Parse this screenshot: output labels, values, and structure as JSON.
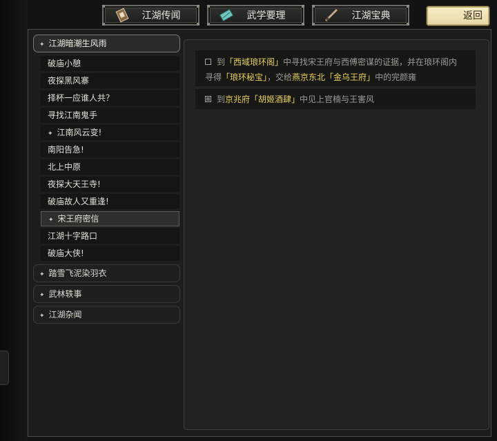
{
  "tabs": [
    {
      "label": "江湖传闻",
      "icon": "scroll-icon"
    },
    {
      "label": "武学要理",
      "icon": "manual-icon"
    },
    {
      "label": "江湖宝典",
      "icon": "sword-icon"
    }
  ],
  "back_label": "返回",
  "chapters": {
    "first": {
      "label": "江湖暗潮生风雨"
    },
    "others": [
      {
        "label": "踏雪飞泥染羽衣"
      },
      {
        "label": "武林轶事"
      },
      {
        "label": "江湖杂闻"
      }
    ]
  },
  "quests": [
    {
      "label": "破庙小憩",
      "starred": false
    },
    {
      "label": "夜探黑风寨",
      "starred": false
    },
    {
      "label": "择杯一应谁人共？",
      "starred": false
    },
    {
      "label": "寻找江南鬼手",
      "starred": false
    },
    {
      "label": "江南风云变!",
      "starred": true
    },
    {
      "label": "南阳告急!",
      "starred": false
    },
    {
      "label": "北上中原",
      "starred": false
    },
    {
      "label": "夜探大天王寺!",
      "starred": false
    },
    {
      "label": "破庙故人又重逢!",
      "starred": false
    },
    {
      "label": "宋王府密信",
      "starred": true,
      "active": true
    },
    {
      "label": "江湖十字路口",
      "starred": false
    },
    {
      "label": "破庙大侠!",
      "starred": false
    }
  ],
  "objectives": [
    {
      "done": false,
      "line1": [
        {
          "t": "到",
          "hl": false
        },
        {
          "t": "「西域琅环阁」",
          "hl": true
        },
        {
          "t": "中寻找宋王府与西傅密谋的证据，并在琅环阁内",
          "hl": false
        }
      ],
      "line2": [
        {
          "t": "寻得",
          "hl": false
        },
        {
          "t": "「琅环秘宝」",
          "hl": true
        },
        {
          "t": "，交给",
          "hl": false
        },
        {
          "t": "燕京东北「金乌王府」",
          "hl": true
        },
        {
          "t": "中的完颜雍",
          "hl": false
        }
      ]
    },
    {
      "done": true,
      "line1": [
        {
          "t": "到",
          "hl": false
        },
        {
          "t": "京兆府「胡姬酒肆」",
          "hl": true
        },
        {
          "t": "中见上官楠与王害风",
          "hl": false
        }
      ]
    }
  ],
  "colors": {
    "highlight": "#e8cf5e",
    "back_button": "#f1e5b8"
  }
}
